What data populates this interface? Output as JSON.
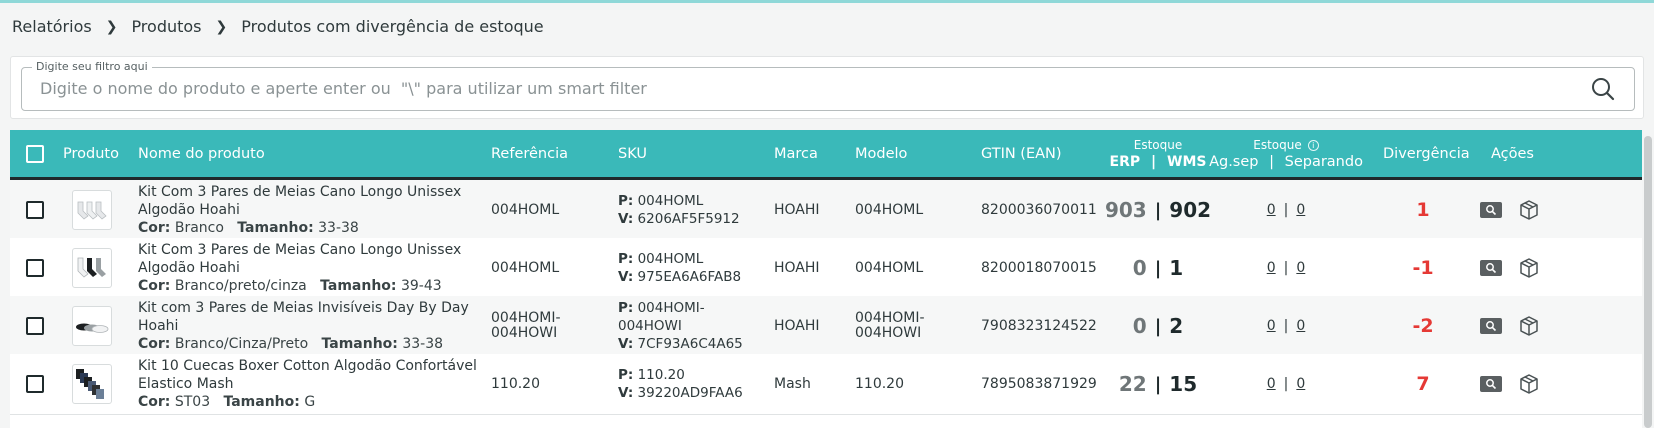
{
  "breadcrumb": {
    "items": [
      "Relatórios",
      "Produtos",
      "Produtos com divergência de estoque"
    ]
  },
  "filter": {
    "label": "Digite seu filtro aqui",
    "placeholder": "Digite o nome do produto e aperte enter ou  \"\\\" para utilizar um smart filter"
  },
  "table": {
    "headers": {
      "produto": "Produto",
      "nome": "Nome do produto",
      "referencia": "Referência",
      "sku": "SKU",
      "marca": "Marca",
      "modelo": "Modelo",
      "gtin": "GTIN (EAN)",
      "estoque1_top": "Estoque",
      "estoque1_erp": "ERP",
      "estoque1_wms": "WMS",
      "estoque2_top": "Estoque",
      "estoque2_agsep": "Ag.sep",
      "estoque2_separando": "Separando",
      "divergencia": "Divergência",
      "acoes": "Ações",
      "sep": "|"
    },
    "labels": {
      "cor": "Cor:",
      "tamanho": "Tamanho:",
      "p": "P:",
      "v": "V:"
    },
    "rows": [
      {
        "name1": "Kit Com 3 Pares de Meias Cano Longo Unissex",
        "name2": "Algodão Hoahi",
        "cor": "Branco",
        "tamanho": "33-38",
        "referencia": "004HOML",
        "sku_p": "004HOML",
        "sku_v": "6206AF5F5912",
        "marca": "HOAHI",
        "modelo": "004HOML",
        "gtin": "8200036070011",
        "erp": "903",
        "wms": "902",
        "agsep": "0",
        "separando": "0",
        "divergencia": "1",
        "thumb": "socks-white"
      },
      {
        "name1": "Kit Com 3 Pares de Meias Cano Longo Unissex",
        "name2": "Algodão Hoahi",
        "cor": "Branco/preto/cinza",
        "tamanho": "39-43",
        "referencia": "004HOML",
        "sku_p": "004HOML",
        "sku_v": "975EA6A6FAB8",
        "marca": "HOAHI",
        "modelo": "004HOML",
        "gtin": "8200018070015",
        "erp": "0",
        "wms": "1",
        "agsep": "0",
        "separando": "0",
        "divergencia": "-1",
        "thumb": "socks-mixed"
      },
      {
        "name1": "Kit com 3 Pares de Meias Invisíveis Day By Day",
        "name2": "Hoahi",
        "cor": "Branco/Cinza/Preto",
        "tamanho": "33-38",
        "referencia1": "004HOMI-",
        "referencia2": "004HOWI",
        "sku_p1": "004HOMI-",
        "sku_p2": "004HOWI",
        "sku_v": "7CF93A6C4A65",
        "marca": "HOAHI",
        "modelo1": "004HOMI-",
        "modelo2": "004HOWI",
        "gtin": "7908323124522",
        "erp": "0",
        "wms": "2",
        "agsep": "0",
        "separando": "0",
        "divergencia": "-2",
        "thumb": "socks-invisible"
      },
      {
        "name1": "Kit 10 Cuecas Boxer Cotton Algodão Confortável",
        "name2": "Elastico Mash",
        "cor": "ST03",
        "tamanho": "G",
        "referencia": "110.20",
        "sku_p": "110.20",
        "sku_v": "39220AD9FAA6",
        "marca": "Mash",
        "modelo": "110.20",
        "gtin": "7895083871929",
        "erp": "22",
        "wms": "15",
        "agsep": "0",
        "separando": "0",
        "divergencia": "7",
        "thumb": "boxers"
      }
    ]
  },
  "colors": {
    "header": "#3ab9b9",
    "divergence": "#e53935"
  }
}
